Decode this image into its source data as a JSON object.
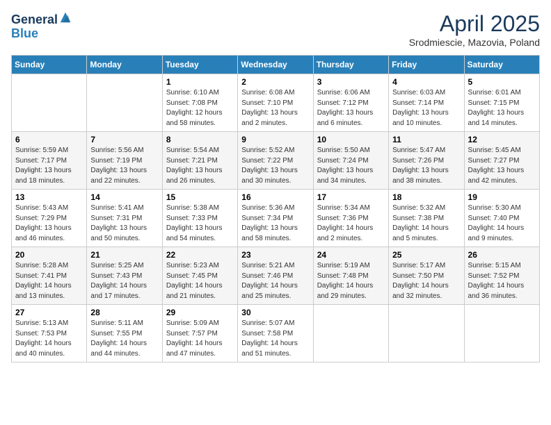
{
  "header": {
    "logo_line1": "General",
    "logo_line2": "Blue",
    "month_year": "April 2025",
    "location": "Srodmiescie, Mazovia, Poland"
  },
  "days_of_week": [
    "Sunday",
    "Monday",
    "Tuesday",
    "Wednesday",
    "Thursday",
    "Friday",
    "Saturday"
  ],
  "weeks": [
    [
      {
        "day": "",
        "sunrise": "",
        "sunset": "",
        "daylight": ""
      },
      {
        "day": "",
        "sunrise": "",
        "sunset": "",
        "daylight": ""
      },
      {
        "day": "1",
        "sunrise": "Sunrise: 6:10 AM",
        "sunset": "Sunset: 7:08 PM",
        "daylight": "Daylight: 12 hours and 58 minutes."
      },
      {
        "day": "2",
        "sunrise": "Sunrise: 6:08 AM",
        "sunset": "Sunset: 7:10 PM",
        "daylight": "Daylight: 13 hours and 2 minutes."
      },
      {
        "day": "3",
        "sunrise": "Sunrise: 6:06 AM",
        "sunset": "Sunset: 7:12 PM",
        "daylight": "Daylight: 13 hours and 6 minutes."
      },
      {
        "day": "4",
        "sunrise": "Sunrise: 6:03 AM",
        "sunset": "Sunset: 7:14 PM",
        "daylight": "Daylight: 13 hours and 10 minutes."
      },
      {
        "day": "5",
        "sunrise": "Sunrise: 6:01 AM",
        "sunset": "Sunset: 7:15 PM",
        "daylight": "Daylight: 13 hours and 14 minutes."
      }
    ],
    [
      {
        "day": "6",
        "sunrise": "Sunrise: 5:59 AM",
        "sunset": "Sunset: 7:17 PM",
        "daylight": "Daylight: 13 hours and 18 minutes."
      },
      {
        "day": "7",
        "sunrise": "Sunrise: 5:56 AM",
        "sunset": "Sunset: 7:19 PM",
        "daylight": "Daylight: 13 hours and 22 minutes."
      },
      {
        "day": "8",
        "sunrise": "Sunrise: 5:54 AM",
        "sunset": "Sunset: 7:21 PM",
        "daylight": "Daylight: 13 hours and 26 minutes."
      },
      {
        "day": "9",
        "sunrise": "Sunrise: 5:52 AM",
        "sunset": "Sunset: 7:22 PM",
        "daylight": "Daylight: 13 hours and 30 minutes."
      },
      {
        "day": "10",
        "sunrise": "Sunrise: 5:50 AM",
        "sunset": "Sunset: 7:24 PM",
        "daylight": "Daylight: 13 hours and 34 minutes."
      },
      {
        "day": "11",
        "sunrise": "Sunrise: 5:47 AM",
        "sunset": "Sunset: 7:26 PM",
        "daylight": "Daylight: 13 hours and 38 minutes."
      },
      {
        "day": "12",
        "sunrise": "Sunrise: 5:45 AM",
        "sunset": "Sunset: 7:27 PM",
        "daylight": "Daylight: 13 hours and 42 minutes."
      }
    ],
    [
      {
        "day": "13",
        "sunrise": "Sunrise: 5:43 AM",
        "sunset": "Sunset: 7:29 PM",
        "daylight": "Daylight: 13 hours and 46 minutes."
      },
      {
        "day": "14",
        "sunrise": "Sunrise: 5:41 AM",
        "sunset": "Sunset: 7:31 PM",
        "daylight": "Daylight: 13 hours and 50 minutes."
      },
      {
        "day": "15",
        "sunrise": "Sunrise: 5:38 AM",
        "sunset": "Sunset: 7:33 PM",
        "daylight": "Daylight: 13 hours and 54 minutes."
      },
      {
        "day": "16",
        "sunrise": "Sunrise: 5:36 AM",
        "sunset": "Sunset: 7:34 PM",
        "daylight": "Daylight: 13 hours and 58 minutes."
      },
      {
        "day": "17",
        "sunrise": "Sunrise: 5:34 AM",
        "sunset": "Sunset: 7:36 PM",
        "daylight": "Daylight: 14 hours and 2 minutes."
      },
      {
        "day": "18",
        "sunrise": "Sunrise: 5:32 AM",
        "sunset": "Sunset: 7:38 PM",
        "daylight": "Daylight: 14 hours and 5 minutes."
      },
      {
        "day": "19",
        "sunrise": "Sunrise: 5:30 AM",
        "sunset": "Sunset: 7:40 PM",
        "daylight": "Daylight: 14 hours and 9 minutes."
      }
    ],
    [
      {
        "day": "20",
        "sunrise": "Sunrise: 5:28 AM",
        "sunset": "Sunset: 7:41 PM",
        "daylight": "Daylight: 14 hours and 13 minutes."
      },
      {
        "day": "21",
        "sunrise": "Sunrise: 5:25 AM",
        "sunset": "Sunset: 7:43 PM",
        "daylight": "Daylight: 14 hours and 17 minutes."
      },
      {
        "day": "22",
        "sunrise": "Sunrise: 5:23 AM",
        "sunset": "Sunset: 7:45 PM",
        "daylight": "Daylight: 14 hours and 21 minutes."
      },
      {
        "day": "23",
        "sunrise": "Sunrise: 5:21 AM",
        "sunset": "Sunset: 7:46 PM",
        "daylight": "Daylight: 14 hours and 25 minutes."
      },
      {
        "day": "24",
        "sunrise": "Sunrise: 5:19 AM",
        "sunset": "Sunset: 7:48 PM",
        "daylight": "Daylight: 14 hours and 29 minutes."
      },
      {
        "day": "25",
        "sunrise": "Sunrise: 5:17 AM",
        "sunset": "Sunset: 7:50 PM",
        "daylight": "Daylight: 14 hours and 32 minutes."
      },
      {
        "day": "26",
        "sunrise": "Sunrise: 5:15 AM",
        "sunset": "Sunset: 7:52 PM",
        "daylight": "Daylight: 14 hours and 36 minutes."
      }
    ],
    [
      {
        "day": "27",
        "sunrise": "Sunrise: 5:13 AM",
        "sunset": "Sunset: 7:53 PM",
        "daylight": "Daylight: 14 hours and 40 minutes."
      },
      {
        "day": "28",
        "sunrise": "Sunrise: 5:11 AM",
        "sunset": "Sunset: 7:55 PM",
        "daylight": "Daylight: 14 hours and 44 minutes."
      },
      {
        "day": "29",
        "sunrise": "Sunrise: 5:09 AM",
        "sunset": "Sunset: 7:57 PM",
        "daylight": "Daylight: 14 hours and 47 minutes."
      },
      {
        "day": "30",
        "sunrise": "Sunrise: 5:07 AM",
        "sunset": "Sunset: 7:58 PM",
        "daylight": "Daylight: 14 hours and 51 minutes."
      },
      {
        "day": "",
        "sunrise": "",
        "sunset": "",
        "daylight": ""
      },
      {
        "day": "",
        "sunrise": "",
        "sunset": "",
        "daylight": ""
      },
      {
        "day": "",
        "sunrise": "",
        "sunset": "",
        "daylight": ""
      }
    ]
  ]
}
